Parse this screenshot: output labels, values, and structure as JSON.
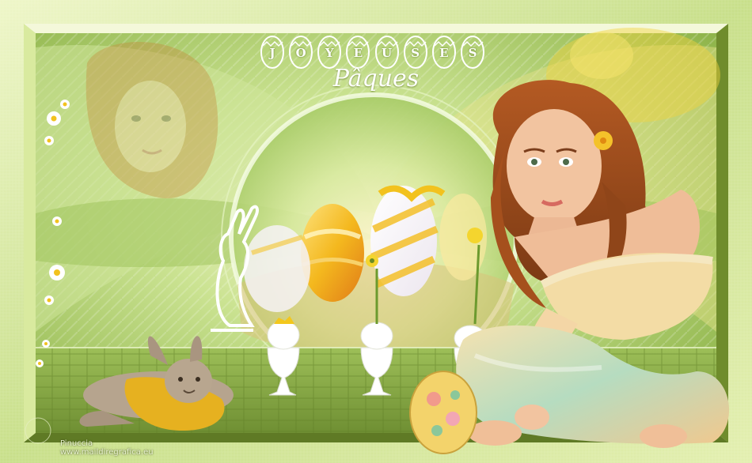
{
  "title": {
    "line1_letters": [
      "J",
      "O",
      "Y",
      "E",
      "U",
      "S",
      "E",
      "S"
    ],
    "line2": "Pâques"
  },
  "watermark": {
    "author": "Pinuccia",
    "site": "www.maildiregrafica.eu"
  },
  "colors": {
    "frame_outer": "#e2efb4",
    "frame_inner": "#7d9a33",
    "background_green": "#a9cf68",
    "floor_green": "#8db04a",
    "egg_yellow": "#f4b81e",
    "egg_orange": "#f08a22",
    "hair": "#9c4a1f",
    "skin": "#f2c4a0",
    "dress_cream": "#f3dca5",
    "dress_mint": "#a8d7bb",
    "bunny_sweater": "#e9b024"
  },
  "scene": {
    "icons": [
      "bunny-silhouette-icon",
      "egg-cup-icon",
      "daisy-icon",
      "easter-egg-icon",
      "flower-icon"
    ]
  }
}
